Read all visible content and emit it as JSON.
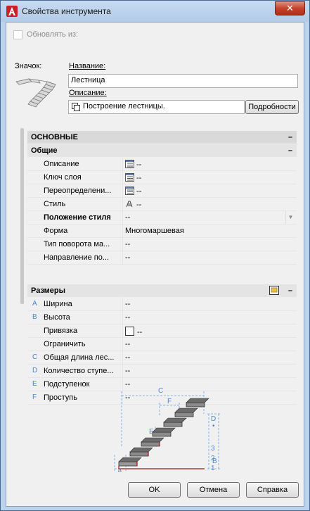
{
  "window": {
    "title": "Свойства инструмента",
    "close_glyph": "✕"
  },
  "update_from": {
    "label": "Обновлять из:",
    "checked": false
  },
  "icon_label": "Значок:",
  "name_field": {
    "label": "Название:",
    "value": "Лестница"
  },
  "description_field": {
    "label": "Описание:",
    "value": "Построение лестницы.",
    "details_button": "Подробности"
  },
  "sections": {
    "basic": {
      "title": "ОСНОВНЫЕ",
      "toggle": "–"
    },
    "general": {
      "title": "Общие",
      "toggle": "–"
    },
    "sizes": {
      "title": "Размеры",
      "toggle": "–"
    }
  },
  "general_props": [
    {
      "name": "Описание",
      "value": "--",
      "icon": "list-icon"
    },
    {
      "name": "Ключ слоя",
      "value": "--",
      "icon": "list-icon"
    },
    {
      "name": "Переопределени...",
      "value": "--",
      "icon": "list-icon"
    },
    {
      "name": "Стиль",
      "value": "--",
      "icon": "style-icon"
    },
    {
      "name": "Положение стиля",
      "value": "--",
      "bold": true,
      "dropdown": true
    },
    {
      "name": "Форма",
      "value": "Многомаршевая"
    },
    {
      "name": "Тип поворота ма...",
      "value": "--"
    },
    {
      "name": "Направление по...",
      "value": "--"
    }
  ],
  "size_props": [
    {
      "letter": "A",
      "name": "Ширина",
      "value": "--"
    },
    {
      "letter": "B",
      "name": "Высота",
      "value": "--"
    },
    {
      "letter": "",
      "name": "Привязка",
      "value": "--",
      "checkbox": true
    },
    {
      "letter": "",
      "name": "Ограничить",
      "value": "--"
    },
    {
      "letter": "C",
      "name": "Общая длина лес...",
      "value": "--"
    },
    {
      "letter": "D",
      "name": "Количество ступе...",
      "value": "--"
    },
    {
      "letter": "E",
      "name": "Подступенок",
      "value": "--"
    },
    {
      "letter": "F",
      "name": "Проступь",
      "value": "--"
    }
  ],
  "diagram": {
    "labels": [
      "C",
      "F",
      "E",
      "D",
      "B",
      "A",
      "1",
      "2",
      "3",
      "•"
    ]
  },
  "buttons": {
    "ok": "OK",
    "cancel": "Отмена",
    "help": "Справка"
  },
  "colors": {
    "accent": "#4a86d8",
    "titlebar": "#bcd3ec",
    "close": "#c4422b"
  }
}
